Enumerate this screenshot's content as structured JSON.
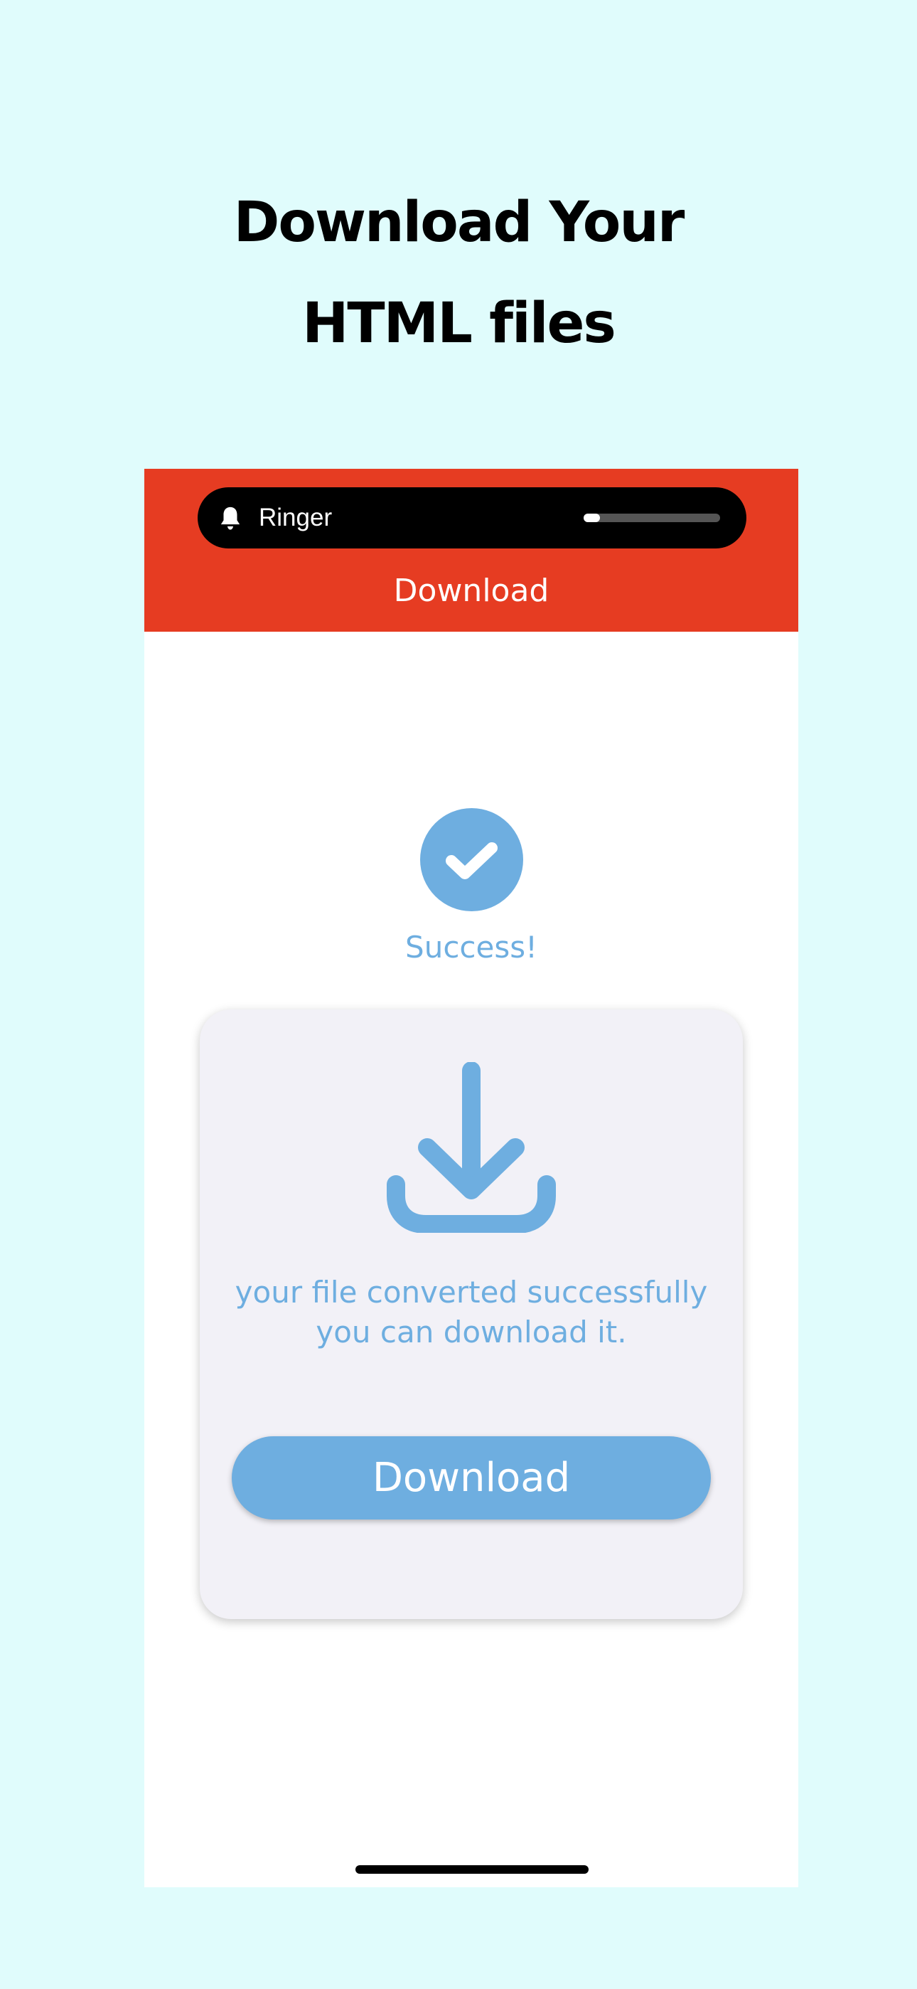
{
  "marketing": {
    "headline_line1": "Download Your",
    "headline_line2": "HTML files"
  },
  "ringer": {
    "label": "Ringer",
    "icon": "bell-icon",
    "volume_fraction": 0.12
  },
  "navbar": {
    "title": "Download"
  },
  "status": {
    "icon": "checkmark-circle-icon",
    "label": "Success!"
  },
  "card": {
    "icon": "download-icon",
    "message": "your file converted successfully you can download it.",
    "button_label": "Download"
  },
  "colors": {
    "page_background": "#e0fcfc",
    "topbar": "#e63c22",
    "accent": "#6eaee0",
    "card_background": "#f2f1f7"
  }
}
